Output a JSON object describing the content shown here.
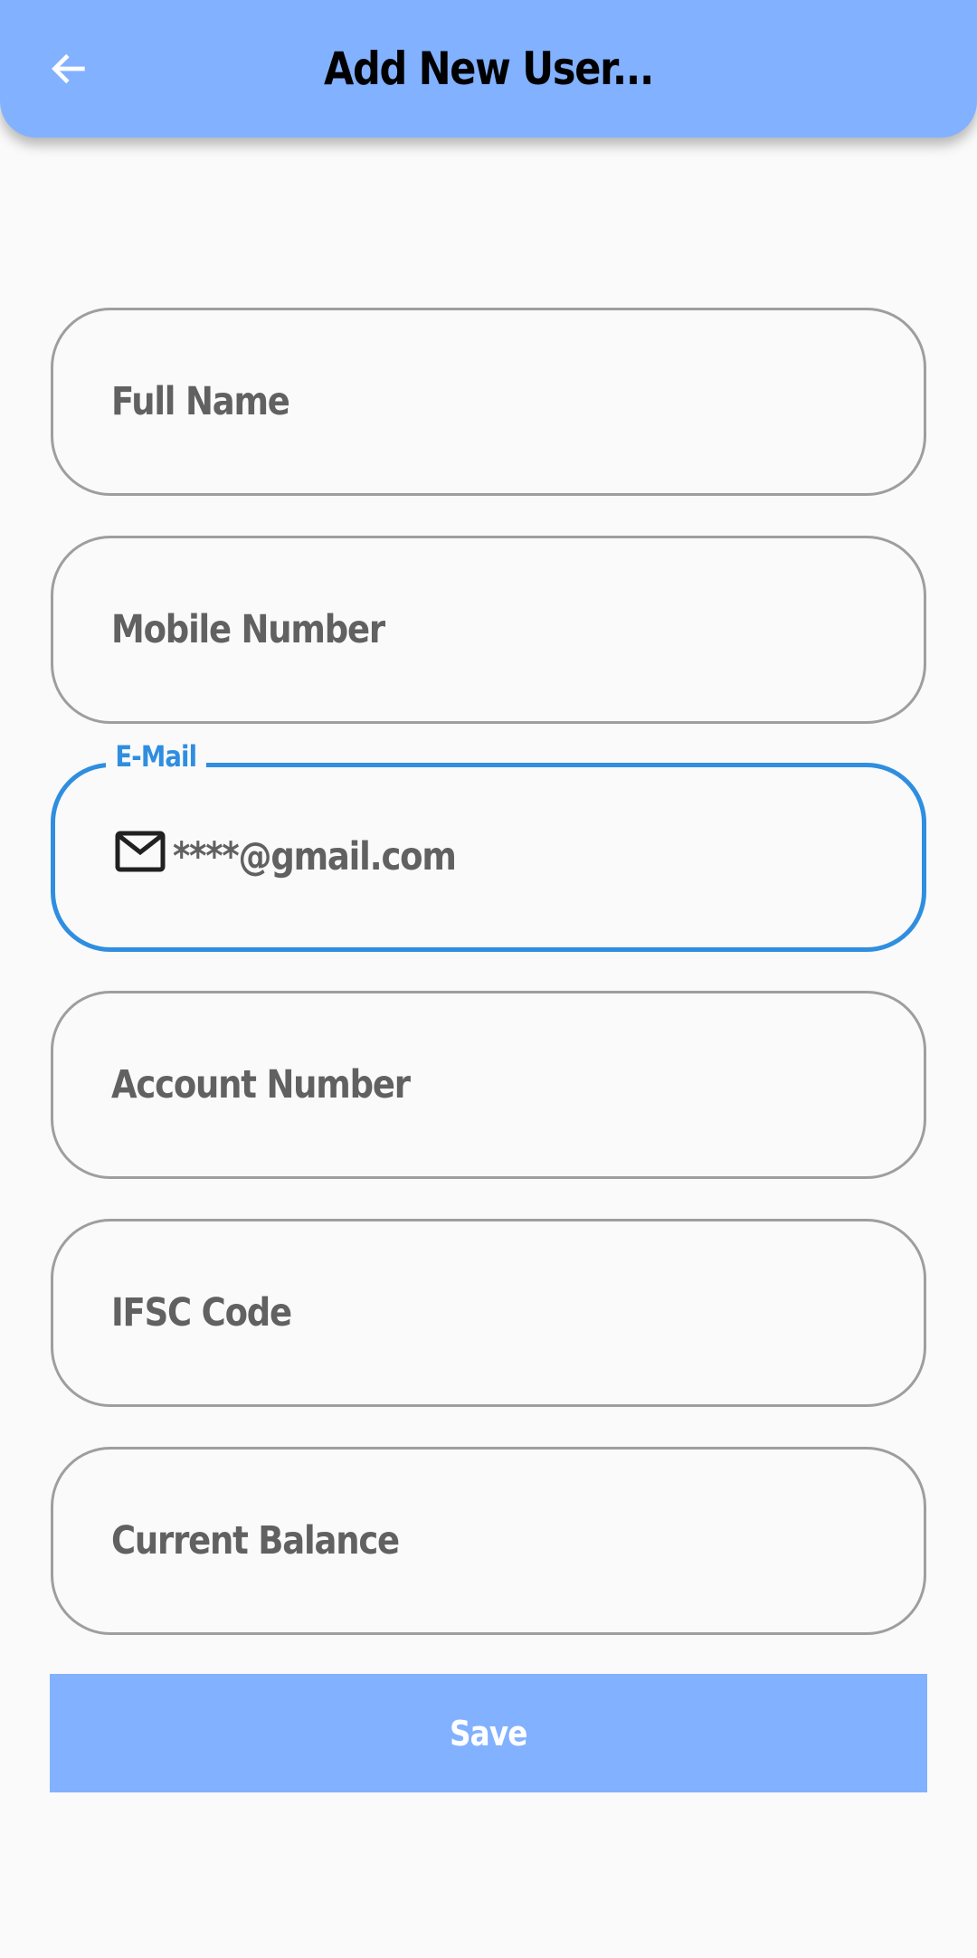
{
  "app_bar": {
    "title": "Add New User...",
    "back_icon": "arrow-back-icon",
    "background_color": "#82b1ff"
  },
  "form": {
    "full_name": {
      "placeholder": "Full Name",
      "value": ""
    },
    "mobile_number": {
      "placeholder": "Mobile Number",
      "value": ""
    },
    "email": {
      "label": "E-Mail",
      "value": "****@gmail.com",
      "icon": "mail-icon",
      "focused": true,
      "focus_color": "#2f8ee0"
    },
    "account_number": {
      "placeholder": "Account Number",
      "value": ""
    },
    "ifsc_code": {
      "placeholder": "IFSC Code",
      "value": ""
    },
    "current_balance": {
      "placeholder": "Current Balance",
      "value": ""
    }
  },
  "save_button": {
    "label": "Save",
    "background_color": "#82b1ff"
  }
}
